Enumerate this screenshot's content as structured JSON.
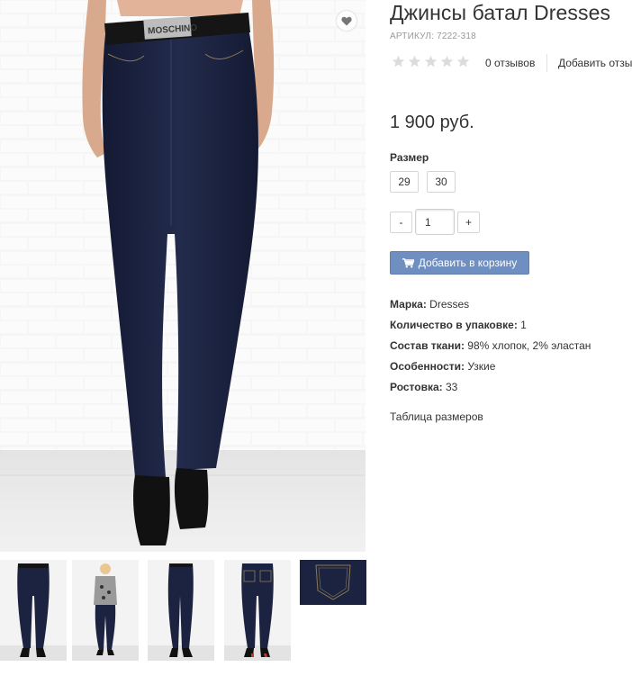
{
  "product": {
    "title": "Джинсы батал Dresses",
    "sku": "АРТИКУЛ: 7222-318",
    "rating": {
      "stars_filled": 0,
      "stars_total": 5,
      "reviews_count": "0 отзывов",
      "add_review": "Добавить отзыв"
    },
    "price": "1 900 руб.",
    "size": {
      "label": "Размер",
      "options": [
        "29",
        "30"
      ]
    },
    "quantity": {
      "minus": "-",
      "value": "1",
      "plus": "+"
    },
    "add_to_cart": "Добавить в корзину",
    "specs": [
      {
        "name": "Марка:",
        "value": "Dresses"
      },
      {
        "name": "Количество в упаковке:",
        "value": "1"
      },
      {
        "name": "Состав ткани:",
        "value": "98% хлопок, 2% эластан"
      },
      {
        "name": "Особенности:",
        "value": "Узкие"
      },
      {
        "name": "Ростовка:",
        "value": "33"
      }
    ],
    "size_table_link": "Таблица размеров"
  },
  "gallery": {
    "main_image": "jeans-front-photo",
    "belt_text": "MOSCHINO",
    "thumbnails": [
      {
        "name": "front-view"
      },
      {
        "name": "model-full-view"
      },
      {
        "name": "side-view"
      },
      {
        "name": "back-view"
      },
      {
        "name": "pocket-detail"
      }
    ]
  },
  "icons": {
    "wishlist": "heart-icon",
    "cart": "cart-icon",
    "star": "star-icon"
  },
  "colors": {
    "denim": "#1c2340",
    "button": "#6f8fc1",
    "star_empty": "#dcdcdc",
    "brick": "#f2f2f2"
  }
}
